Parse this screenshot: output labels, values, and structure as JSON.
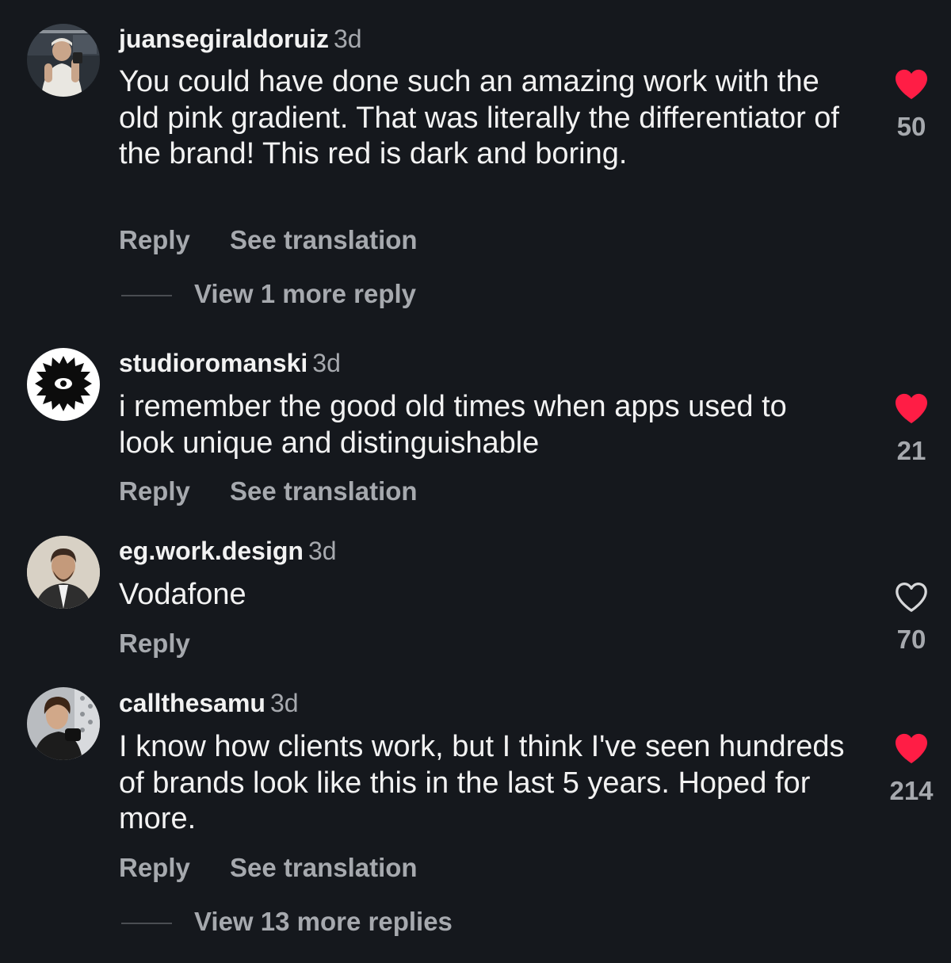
{
  "comments": [
    {
      "username": "juansegiraldoruiz",
      "time": "3d",
      "text": "You could have done such an amazing work with the old pink gradient. That was literally the differentiator of the brand! This red is dark and boring.",
      "reply_label": "Reply",
      "translate_label": "See translation",
      "view_replies": "View 1 more reply",
      "likes": "50",
      "liked": true
    },
    {
      "username": "studioromanski",
      "time": "3d",
      "text": "i remember the good old times when apps used to look unique and distinguishable",
      "reply_label": "Reply",
      "translate_label": "See translation",
      "likes": "21",
      "liked": true
    },
    {
      "username": "eg.work.design",
      "time": "3d",
      "text": "Vodafone",
      "reply_label": "Reply",
      "likes": "70",
      "liked": false
    },
    {
      "username": "callthesamu",
      "time": "3d",
      "text": "I know how clients work, but I think I've seen hundreds of brands look like this in the last 5 years. Hoped for more.",
      "reply_label": "Reply",
      "translate_label": "See translation",
      "view_replies": "View 13 more replies",
      "likes": "214",
      "liked": true
    }
  ],
  "colors": {
    "background": "#15181d",
    "text_primary": "#f2f2f2",
    "text_secondary": "#a6a9ae",
    "heart_liked": "#ff1d45"
  },
  "icons": {
    "liked": "heart-filled-icon",
    "unliked": "heart-outline-icon"
  }
}
